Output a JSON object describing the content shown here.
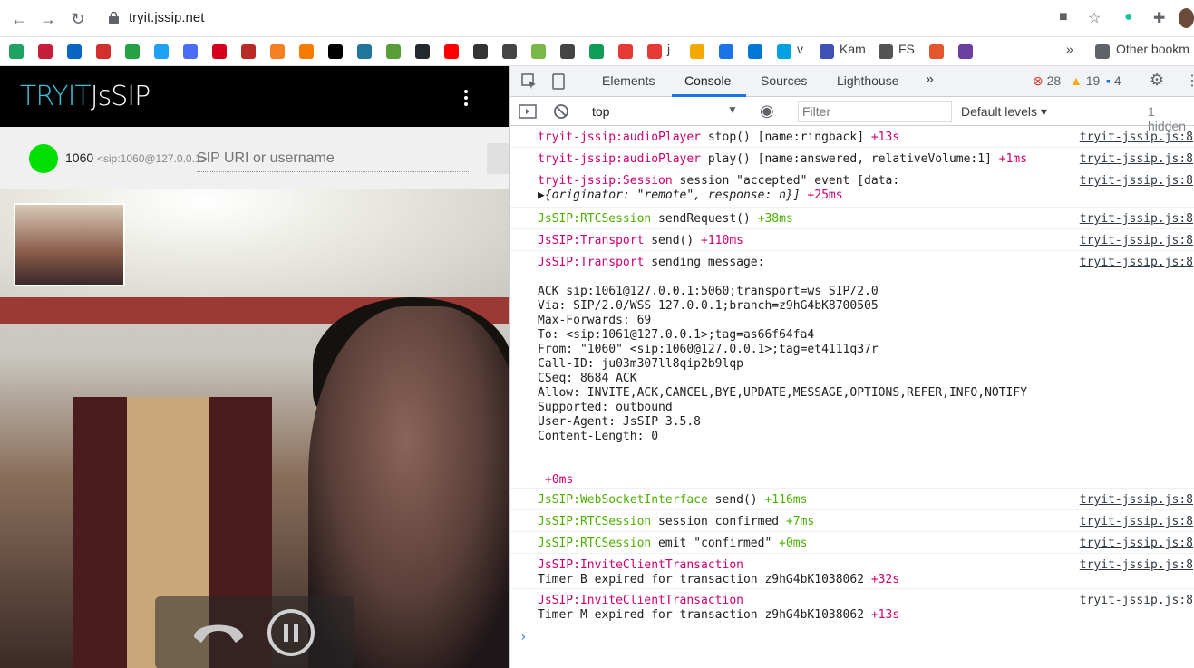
{
  "browser": {
    "url": "tryit.jssip.net",
    "other_bookmarks": "Other bookm"
  },
  "bookmarks": [
    {
      "label": "",
      "color": "#1ea362"
    },
    {
      "label": "",
      "color": "#c41e3a"
    },
    {
      "label": "",
      "color": "#0a66c2"
    },
    {
      "label": "",
      "color": "#d32f2f"
    },
    {
      "label": "",
      "color": "#25a244"
    },
    {
      "label": "",
      "color": "#1da1f2"
    },
    {
      "label": "",
      "color": "#4a6cf7"
    },
    {
      "label": "",
      "color": "#d6001c"
    },
    {
      "label": "",
      "color": "#b92b27"
    },
    {
      "label": "",
      "color": "#f48024"
    },
    {
      "label": "",
      "color": "#f57c00"
    },
    {
      "label": "",
      "color": "#000000"
    },
    {
      "label": "",
      "color": "#21759b"
    },
    {
      "label": "",
      "color": "#5a9e3a"
    },
    {
      "label": "",
      "color": "#24292e"
    },
    {
      "label": "",
      "color": "#ff0000"
    },
    {
      "label": "",
      "color": "#333333"
    },
    {
      "label": "",
      "color": "#444444"
    },
    {
      "label": "",
      "color": "#7ab648"
    },
    {
      "label": "",
      "color": "#444444"
    },
    {
      "label": "",
      "color": "#0f9d58"
    },
    {
      "label": "",
      "color": "#e53935"
    },
    {
      "label": "j",
      "color": "#e53935"
    },
    {
      "label": "",
      "color": "#f2a900"
    },
    {
      "label": "",
      "color": "#1a73e8"
    },
    {
      "label": "",
      "color": "#0078d4"
    },
    {
      "label": "v",
      "color": "#00a1e0"
    },
    {
      "label": "Kam",
      "color": "#3f51b5"
    },
    {
      "label": "FS",
      "color": "#555555"
    },
    {
      "label": "",
      "color": "#e4572e"
    },
    {
      "label": "",
      "color": "#6a3fa0"
    }
  ],
  "app": {
    "logo_prefix": "TRYIT",
    "logo_suffix": "JsSIP",
    "extension": "1060",
    "uri": "<sip:1060@127.0.0.1>",
    "input_placeholder": "SIP URI or username"
  },
  "devtools": {
    "tabs": [
      "Elements",
      "Console",
      "Sources",
      "Lighthouse"
    ],
    "more": "»",
    "errors": "28",
    "warnings": "19",
    "messages": "4",
    "context": "top",
    "filter_placeholder": "Filter",
    "levels": "Default levels",
    "hidden": "1 hidden"
  },
  "console": [
    {
      "ns": "tryit-jssip:audioPlayer",
      "text": " stop() [name:ringback] ",
      "delta": "+13s",
      "ns_color": "red",
      "src": "tryit-jssip.js:8"
    },
    {
      "ns": "tryit-jssip:audioPlayer",
      "text": " play() [name:answered, relativeVolume:1] ",
      "delta": "+1ms",
      "ns_color": "red",
      "src": "tryit-jssip.js:8"
    },
    {
      "ns": "tryit-jssip:Session",
      "text": " session \"accepted\" event [data:",
      "delta": "",
      "ns_color": "red",
      "src": "tryit-jssip.js:8",
      "sub": "▶{originator: \"remote\", response: n}] ",
      "sub_delta": "+25ms"
    },
    {
      "ns": "JsSIP:RTCSession",
      "text": " sendRequest() ",
      "delta": "+38ms",
      "ns_color": "green",
      "src": "tryit-jssip.js:8"
    },
    {
      "ns": "JsSIP:Transport",
      "text": " send() ",
      "delta": "+110ms",
      "ns_color": "red",
      "src": "tryit-jssip.js:8"
    },
    {
      "ns": "JsSIP:Transport",
      "text": " sending message:",
      "delta": "",
      "ns_color": "red",
      "src": "tryit-jssip.js:8"
    }
  ],
  "sip_message": [
    "ACK sip:1061@127.0.0.1:5060;transport=ws SIP/2.0",
    "Via: SIP/2.0/WSS 127.0.0.1;branch=z9hG4bK8700505",
    "Max-Forwards: 69",
    "To: <sip:1061@127.0.0.1>;tag=as66f64fa4",
    "From: \"1060\" <sip:1060@127.0.0.1>;tag=et4111q37r",
    "Call-ID: ju03m307ll8qip2b9lqp",
    "CSeq: 8684 ACK",
    "Allow: INVITE,ACK,CANCEL,BYE,UPDATE,MESSAGE,OPTIONS,REFER,INFO,NOTIFY",
    "Supported: outbound",
    "User-Agent: JsSIP 3.5.8",
    "Content-Length: 0"
  ],
  "sip_delta": "+0ms",
  "console_after": [
    {
      "ns": "JsSIP:WebSocketInterface",
      "text": " send() ",
      "delta": "+116ms",
      "ns_color": "green",
      "src": "tryit-jssip.js:8"
    },
    {
      "ns": "JsSIP:RTCSession",
      "text": " session confirmed ",
      "delta": "+7ms",
      "ns_color": "green",
      "src": "tryit-jssip.js:8"
    },
    {
      "ns": "JsSIP:RTCSession",
      "text": " emit \"confirmed\" ",
      "delta": "+0ms",
      "ns_color": "green",
      "src": "tryit-jssip.js:8"
    },
    {
      "ns": "JsSIP:InviteClientTransaction",
      "text": "",
      "delta": "",
      "ns_color": "red",
      "src": "tryit-jssip.js:8",
      "sub": "Timer B expired for transaction z9hG4bK1038062 ",
      "sub_delta": "+32s"
    },
    {
      "ns": "JsSIP:InviteClientTransaction",
      "text": "",
      "delta": "",
      "ns_color": "red",
      "src": "tryit-jssip.js:8",
      "sub": "Timer M expired for transaction z9hG4bK1038062 ",
      "sub_delta": "+13s"
    }
  ],
  "prompt": "›"
}
